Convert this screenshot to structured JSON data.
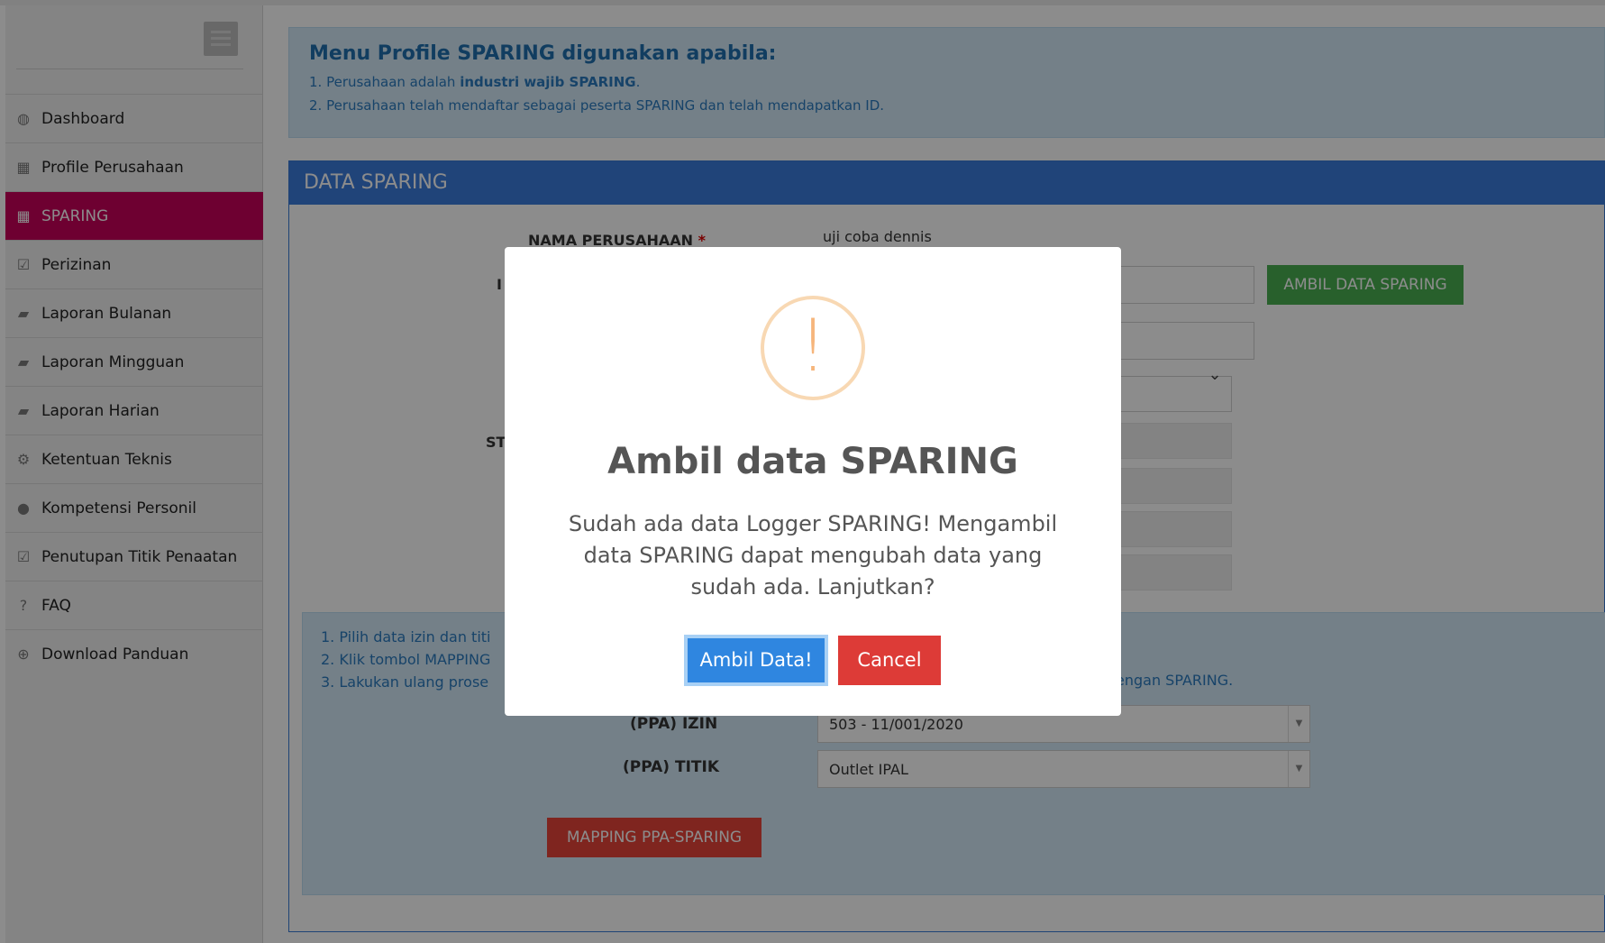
{
  "sidebar": {
    "items": [
      {
        "label": "Dashboard",
        "icon": "dashboard-icon",
        "glyph": "◍"
      },
      {
        "label": "Profile Perusahaan",
        "icon": "building-icon",
        "glyph": "▦"
      },
      {
        "label": "SPARING",
        "icon": "building-icon",
        "glyph": "▦",
        "active": true
      },
      {
        "label": "Perizinan",
        "icon": "checkbox-icon",
        "glyph": "☑"
      },
      {
        "label": "Laporan Bulanan",
        "icon": "book-icon",
        "glyph": "▰"
      },
      {
        "label": "Laporan Mingguan",
        "icon": "book-icon",
        "glyph": "▰"
      },
      {
        "label": "Laporan Harian",
        "icon": "book-icon",
        "glyph": "▰"
      },
      {
        "label": "Ketentuan Teknis",
        "icon": "gears-icon",
        "glyph": "⚙"
      },
      {
        "label": "Kompetensi Personil",
        "icon": "user-icon",
        "glyph": "●"
      },
      {
        "label": "Penutupan Titik Penaatan",
        "icon": "checkbox-icon",
        "glyph": "☑"
      },
      {
        "label": "FAQ",
        "icon": "question-icon",
        "glyph": "?"
      },
      {
        "label": "Download Panduan",
        "icon": "download-icon",
        "glyph": "⊕"
      }
    ]
  },
  "info": {
    "title": "Menu Profile SPARING digunakan apabila:",
    "line1_pre": "1. Perusahaan adalah ",
    "line1_bold": "industri wajib SPARING",
    "line1_post": ".",
    "line2": "2. Perusahaan telah mendaftar sebagai peserta SPARING dan telah mendapatkan ID."
  },
  "panel": {
    "title": "DATA SPARING",
    "nama_label": "NAMA PERUSAHAAN",
    "required_mark": "*",
    "nama_value": "uji coba dennis",
    "partial_label_1": "I",
    "partial_label_2": "ST",
    "ambil_button": "AMBIL DATA SPARING"
  },
  "steps": {
    "step1": "1. Pilih data izin dan titi",
    "step2": "2. Klik tombol MAPPING",
    "step3": "3. Lakukan ulang prose",
    "step3_tail": "engan SPARING.",
    "izin_label": "(PPA) IZIN",
    "izin_value": "503 - 11/001/2020",
    "titik_label": "(PPA) TITIK",
    "titik_value": "Outlet IPAL",
    "mapping_button": "MAPPING PPA-SPARING",
    "caret": "▼"
  },
  "modal": {
    "icon": "warning-icon",
    "icon_glyph": "!",
    "title": "Ambil data SPARING",
    "text": "Sudah ada data Logger SPARING! Mengambil data SPARING dapat mengubah data yang sudah ada. Lanjutkan?",
    "confirm": "Ambil Data!",
    "cancel": "Cancel"
  },
  "colors": {
    "active_menu": "#c9005a",
    "panel_header": "#3b7ddd",
    "confirm": "#2f86e0",
    "cancel": "#dd3b37",
    "ambil_button": "#4aaf51",
    "mapping_button": "#e8443a"
  }
}
